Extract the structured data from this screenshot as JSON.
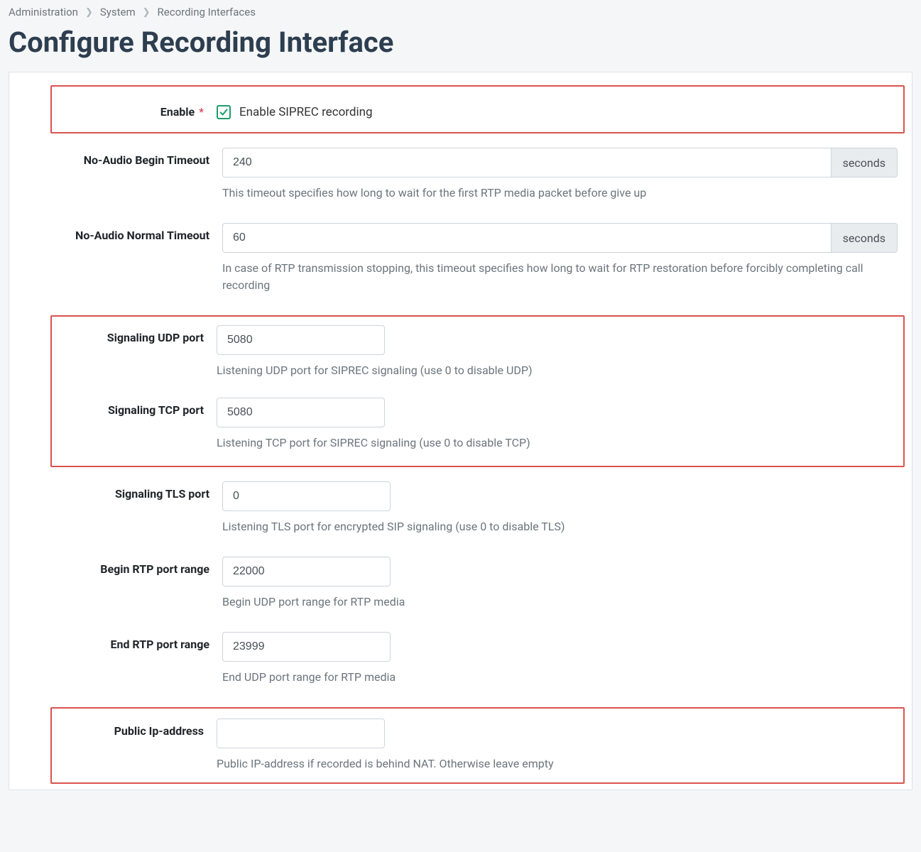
{
  "breadcrumb": {
    "administration": "Administration",
    "system": "System",
    "recording_interfaces": "Recording Interfaces"
  },
  "page": {
    "title": "Configure Recording Interface"
  },
  "labels": {
    "enable": "Enable",
    "no_audio_begin": "No-Audio Begin Timeout",
    "no_audio_normal": "No-Audio Normal Timeout",
    "sig_udp": "Signaling UDP port",
    "sig_tcp": "Signaling TCP port",
    "sig_tls": "Signaling TLS port",
    "begin_rtp": "Begin RTP port range",
    "end_rtp": "End RTP port range",
    "public_ip": "Public Ip-address"
  },
  "fields": {
    "enable": {
      "checked": true,
      "text": "Enable SIPREC recording"
    },
    "no_audio_begin": {
      "value": "240",
      "addon": "seconds",
      "help": "This timeout specifies how long to wait for the first RTP media packet before give up"
    },
    "no_audio_normal": {
      "value": "60",
      "addon": "seconds",
      "help": "In case of RTP transmission stopping, this timeout specifies how long to wait for RTP restoration before forcibly completing call recording"
    },
    "sig_udp": {
      "value": "5080",
      "help": "Listening UDP port for SIPREC signaling (use 0 to disable UDP)"
    },
    "sig_tcp": {
      "value": "5080",
      "help": "Listening TCP port for SIPREC signaling (use 0 to disable TCP)"
    },
    "sig_tls": {
      "value": "0",
      "help": "Listening TLS port for encrypted SIP signaling (use 0 to disable TLS)"
    },
    "begin_rtp": {
      "value": "22000",
      "help": "Begin UDP port range for RTP media"
    },
    "end_rtp": {
      "value": "23999",
      "help": "End UDP port range for RTP media"
    },
    "public_ip": {
      "value": "",
      "help": "Public IP-address if recorded is behind NAT. Otherwise leave empty"
    }
  }
}
